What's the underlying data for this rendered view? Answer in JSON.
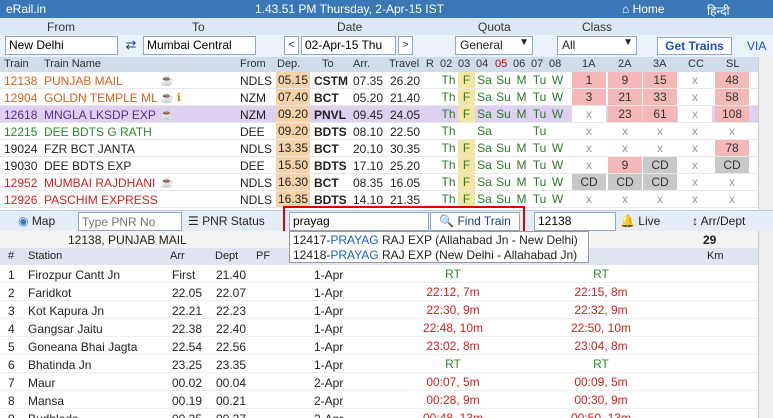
{
  "topbar": {
    "brand": "eRail.in",
    "clock": "1.43.51 PM Thursday, 2-Apr-15 IST",
    "home": "Home",
    "hindi": "हिन्दी"
  },
  "labels": {
    "from": "From",
    "to": "To",
    "date": "Date",
    "quota": "Quota",
    "class": "Class"
  },
  "search": {
    "from": "New Delhi",
    "to": "Mumbai Central",
    "date": "02-Apr-15 Thu",
    "quota": "General",
    "class": "All",
    "get_trains": "Get Trains",
    "via": "VIA",
    "prev": "<",
    "next": ">",
    "swap": "⇄"
  },
  "table_header": {
    "train": "Train",
    "name": "Train Name",
    "from": "From",
    "dep": "Dep.",
    "to": "To",
    "arr": "Arr.",
    "travel": "Travel",
    "r": "R",
    "days": [
      "02",
      "03",
      "04",
      "05",
      "06",
      "07",
      "08"
    ],
    "classes": [
      "1A",
      "2A",
      "3A",
      "CC",
      "SL"
    ]
  },
  "colors": {
    "topbar": "#3a77b7",
    "orange": "#d9601c",
    "green": "#2a8a2a",
    "purple": "#5a2a9a",
    "red": "#d02020",
    "pink": "#f4b8b8",
    "peach": "#f6d2a8",
    "yellow": "#f2e6a0",
    "grey": "#c8c8c8"
  },
  "trains": [
    {
      "no": "12138",
      "name": "PUNJAB MAIL",
      "icons": "☕",
      "from": "NDLS",
      "dep": "05.15",
      "to": "CSTM",
      "arr": "07.35",
      "travel": "26.20",
      "days": [
        "Th",
        "F",
        "Sa",
        "Su",
        "M",
        "Tu",
        "W"
      ],
      "cls": [
        "1",
        "9",
        "15",
        "x",
        "48"
      ],
      "color": "orange"
    },
    {
      "no": "12904",
      "name": "GOLDN TEMPLE ML",
      "icons": "☕ ℹ",
      "from": "NZM",
      "dep": "07.40",
      "to": "BCT",
      "arr": "05.20",
      "travel": "21.40",
      "days": [
        "Th",
        "F",
        "Sa",
        "Su",
        "M",
        "Tu",
        "W"
      ],
      "cls": [
        "3",
        "21",
        "33",
        "x",
        "58"
      ],
      "color": "orange"
    },
    {
      "no": "12618",
      "name": "MNGLA LKSDP EXP",
      "icons": "☕",
      "from": "NZM",
      "dep": "09.20",
      "to": "PNVL",
      "arr": "09.45",
      "travel": "24.05",
      "days": [
        "Th",
        "F",
        "Sa",
        "Su",
        "M",
        "Tu",
        "W"
      ],
      "cls": [
        "x",
        "23",
        "61",
        "x",
        "108"
      ],
      "color": "purple"
    },
    {
      "no": "12215",
      "name": "DEE BDTS G RATH",
      "icons": "",
      "from": "DEE",
      "dep": "09.20",
      "to": "BDTS",
      "arr": "08.10",
      "travel": "22.50",
      "days": [
        "Th",
        "",
        "Sa",
        "",
        "",
        "Tu",
        ""
      ],
      "cls": [
        "x",
        "x",
        "x",
        "x",
        "x"
      ],
      "color": "green"
    },
    {
      "no": "19024",
      "name": "FZR BCT JANTA",
      "icons": "",
      "from": "NDLS",
      "dep": "13.35",
      "to": "BCT",
      "arr": "20.10",
      "travel": "30.35",
      "days": [
        "Th",
        "F",
        "Sa",
        "Su",
        "M",
        "Tu",
        "W"
      ],
      "cls": [
        "x",
        "x",
        "x",
        "x",
        "78"
      ],
      "color": "black"
    },
    {
      "no": "19030",
      "name": "DEE BDTS EXP",
      "icons": "",
      "from": "DEE",
      "dep": "15.50",
      "to": "BDTS",
      "arr": "17.10",
      "travel": "25.20",
      "days": [
        "Th",
        "F",
        "Sa",
        "Su",
        "M",
        "Tu",
        "W"
      ],
      "cls": [
        "x",
        "9",
        "CD",
        "x",
        "CD"
      ],
      "color": "black"
    },
    {
      "no": "12952",
      "name": "MUMBAI RAJDHANI",
      "icons": "☕",
      "from": "NDLS",
      "dep": "16.30",
      "to": "BCT",
      "arr": "08.35",
      "travel": "16.05",
      "days": [
        "Th",
        "F",
        "Sa",
        "Su",
        "M",
        "Tu",
        "W"
      ],
      "cls": [
        "CD",
        "CD",
        "CD",
        "x",
        "x"
      ],
      "color": "red"
    },
    {
      "no": "12926",
      "name": "PASCHIM EXPRESS",
      "icons": "",
      "from": "NDLS",
      "dep": "16.35",
      "to": "BDTS",
      "arr": "14.10",
      "travel": "21.35",
      "days": [
        "Th",
        "F",
        "Sa",
        "Su",
        "M",
        "Tu",
        "W"
      ],
      "cls": [
        "x",
        "x",
        "x",
        "x",
        "x"
      ],
      "color": "red"
    }
  ],
  "toolbar": {
    "map": "Map",
    "pnr_placeholder": "Type PNR No",
    "pnr_status": "PNR Status",
    "find_value": "prayag",
    "find_train": "Find Train",
    "train_no": "12138",
    "live": "Live",
    "arr_dept": "Arr/Dept"
  },
  "suggestions": [
    {
      "no": "12417-",
      "match": "PRAYAG",
      "rest": " RAJ EXP (Allahabad Jn - New Delhi)"
    },
    {
      "no": "12418-",
      "match": "PRAYAG",
      "rest": " RAJ EXP (New Delhi - Allahabad Jn)"
    }
  ],
  "detail": {
    "title": "12138, PUNJAB MAIL",
    "right_num": "29"
  },
  "station_header": {
    "num": "#",
    "station": "Station",
    "arr": "Arr",
    "dept": "Dept",
    "pf": "PF",
    "km": "Km"
  },
  "stations": [
    {
      "n": "1",
      "name": "Firozpur Cantt Jn",
      "arr": "First",
      "dept": "21.40",
      "day": "1-Apr",
      "a": "RT",
      "d": "RT"
    },
    {
      "n": "2",
      "name": "Faridkot",
      "arr": "22.05",
      "dept": "22.07",
      "day": "1-Apr",
      "a": "22:12, 7m",
      "d": "22:15, 8m"
    },
    {
      "n": "3",
      "name": "Kot Kapura Jn",
      "arr": "22.21",
      "dept": "22.23",
      "day": "1-Apr",
      "a": "22:30, 9m",
      "d": "22:32, 9m"
    },
    {
      "n": "4",
      "name": "Gangsar Jaitu",
      "arr": "22.38",
      "dept": "22.40",
      "day": "1-Apr",
      "a": "22:48, 10m",
      "d": "22:50, 10m"
    },
    {
      "n": "5",
      "name": "Goneana Bhai Jagta",
      "arr": "22.54",
      "dept": "22.56",
      "day": "1-Apr",
      "a": "23:02, 8m",
      "d": "23:04, 8m"
    },
    {
      "n": "6",
      "name": "Bhatinda Jn",
      "arr": "23.25",
      "dept": "23.35",
      "day": "1-Apr",
      "a": "RT",
      "d": "RT"
    },
    {
      "n": "7",
      "name": "Maur",
      "arr": "00.02",
      "dept": "00.04",
      "day": "2-Apr",
      "a": "00:07, 5m",
      "d": "00:09, 5m"
    },
    {
      "n": "8",
      "name": "Mansa",
      "arr": "00.19",
      "dept": "00.21",
      "day": "2-Apr",
      "a": "00:28, 9m",
      "d": "00:30, 9m"
    },
    {
      "n": "9",
      "name": "Budhlada",
      "arr": "00.35",
      "dept": "00.37",
      "day": "2-Apr",
      "a": "00:48, 13m",
      "d": "00:50, 13m"
    }
  ]
}
